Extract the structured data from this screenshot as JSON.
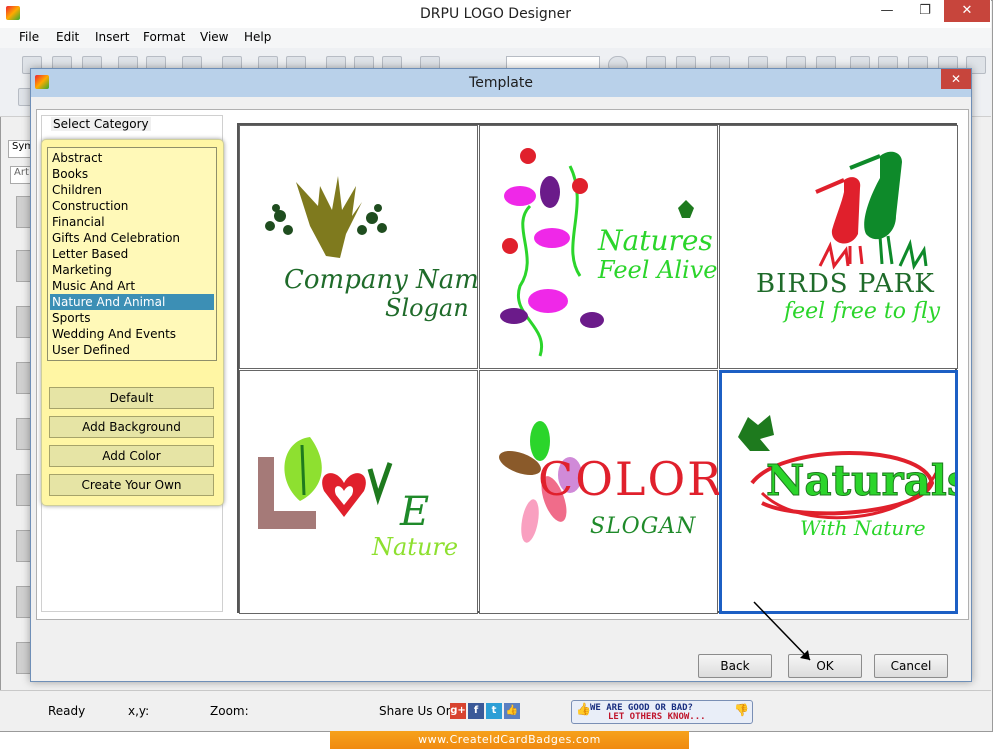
{
  "app": {
    "title": "DRPU LOGO Designer"
  },
  "menu": [
    "File",
    "Edit",
    "Insert",
    "Format",
    "View",
    "Help"
  ],
  "left_tabs": {
    "tab1": "Sym",
    "tab2": "Art"
  },
  "status": {
    "ready": "Ready",
    "coords": "x,y:",
    "zoom": "Zoom:",
    "share_label": "Share Us On:"
  },
  "share_icons": [
    "google-plus-icon",
    "facebook-icon",
    "twitter-icon",
    "thumbs-up-icon"
  ],
  "feedback": {
    "line1": "WE ARE GOOD OR BAD?",
    "line2": "LET OTHERS KNOW..."
  },
  "website": "www.CreateIdCardBadges.com",
  "dialog": {
    "title": "Template",
    "category_label": "Select Category",
    "categories": [
      "Abstract",
      "Books",
      "Children",
      "Construction",
      "Financial",
      "Gifts And Celebration",
      "Letter Based",
      "Marketing",
      "Music And Art",
      "Nature And Animal",
      "Sports",
      "Wedding And Events",
      "User Defined"
    ],
    "selected_category": "Nature And Animal",
    "buttons": {
      "default": "Default",
      "add_background": "Add Background",
      "add_color": "Add Color",
      "create_own": "Create Your Own"
    },
    "footer": {
      "back": "Back",
      "ok": "OK",
      "cancel": "Cancel"
    }
  },
  "templates": [
    {
      "line1": "Company Name",
      "line2": "Slogan"
    },
    {
      "line1": "Natures",
      "line2": "Feel Alive"
    },
    {
      "line1": "BIRDS PARK",
      "line2": "feel free to fly"
    },
    {
      "line1": "E",
      "line2": "Nature"
    },
    {
      "line1": "COLOR",
      "line2": "SLOGAN"
    },
    {
      "line1": "Naturals",
      "line2": "With Nature"
    }
  ],
  "colors": {
    "accent": "#3c8fb5",
    "category_bg": "#fff6a4",
    "selection_border": "#1c5fc4",
    "close_red": "#c7453c"
  }
}
